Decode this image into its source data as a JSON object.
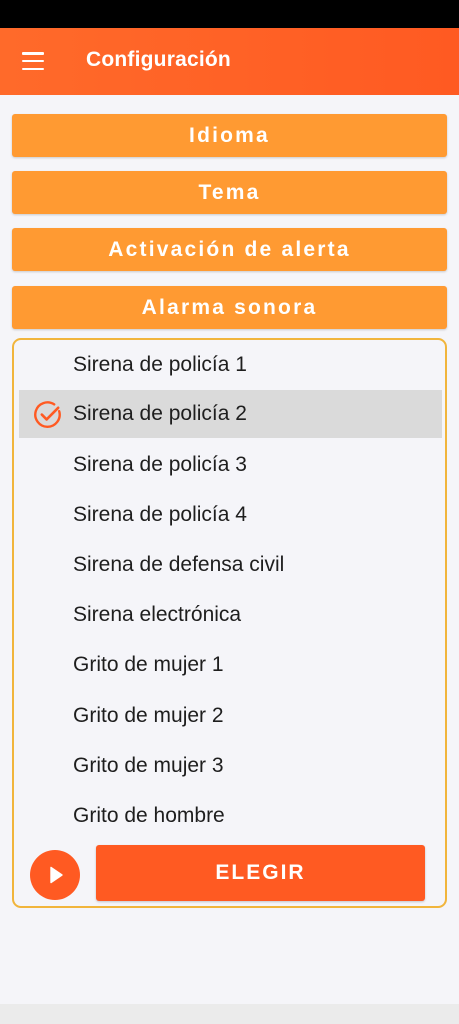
{
  "app_bar": {
    "title": "Configuración",
    "menu_icon": "hamburger-menu-icon",
    "color": "#ff5a22"
  },
  "sections": [
    {
      "label": "Idioma"
    },
    {
      "label": "Tema"
    },
    {
      "label": "Activación de alerta"
    },
    {
      "label": "Alarma sonora"
    }
  ],
  "alarm_panel": {
    "border_color": "#f1b53c",
    "options": [
      {
        "label": "Sirena de policía 1",
        "selected": false
      },
      {
        "label": "Sirena de policía 2",
        "selected": true
      },
      {
        "label": "Sirena de policía 3",
        "selected": false
      },
      {
        "label": "Sirena de policía 4",
        "selected": false
      },
      {
        "label": "Sirena de defensa civil",
        "selected": false
      },
      {
        "label": "Sirena electrónica",
        "selected": false
      },
      {
        "label": "Grito de mujer 1",
        "selected": false
      },
      {
        "label": "Grito de mujer 2",
        "selected": false
      },
      {
        "label": "Grito de mujer 3",
        "selected": false
      },
      {
        "label": "Grito de hombre",
        "selected": false
      }
    ],
    "selected_icon": "check-circle-icon",
    "play_icon": "play-icon",
    "choose_label": "ELEGIR"
  },
  "colors": {
    "section_button": "#ff9a32",
    "accent": "#ff5a22",
    "selected_row": "#dadada"
  }
}
